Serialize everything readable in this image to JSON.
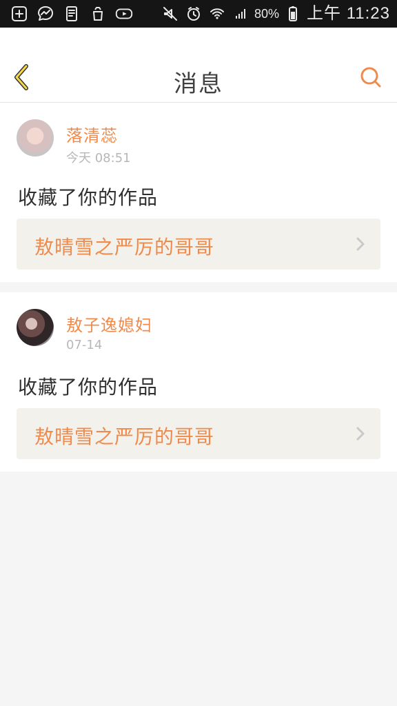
{
  "status_bar": {
    "battery": "80%",
    "time_label": "上午 11:23"
  },
  "header": {
    "title": "消息"
  },
  "messages": [
    {
      "username": "落清蕊",
      "time": "今天 08:51",
      "action": "收藏了你的作品",
      "work_title": "敖晴雪之严厉的哥哥"
    },
    {
      "username": "敖子逸媳妇",
      "time": "07-14",
      "action": "收藏了你的作品",
      "work_title": "敖晴雪之严厉的哥哥"
    }
  ],
  "colors": {
    "accent": "#f08a4b",
    "title_text": "#404040",
    "time_text": "#b7b7b7",
    "work_bg": "#f2f1ec",
    "page_bg": "#f5f5f5"
  },
  "icons": {
    "back": "chevron-left-icon",
    "search": "search-icon",
    "status_left": [
      "add-icon",
      "messenger-icon",
      "doc-icon",
      "recycle-icon",
      "youtube-icon"
    ],
    "status_right": [
      "mute-icon",
      "alarm-icon",
      "wifi-icon",
      "signal-icon",
      "battery-icon"
    ]
  }
}
